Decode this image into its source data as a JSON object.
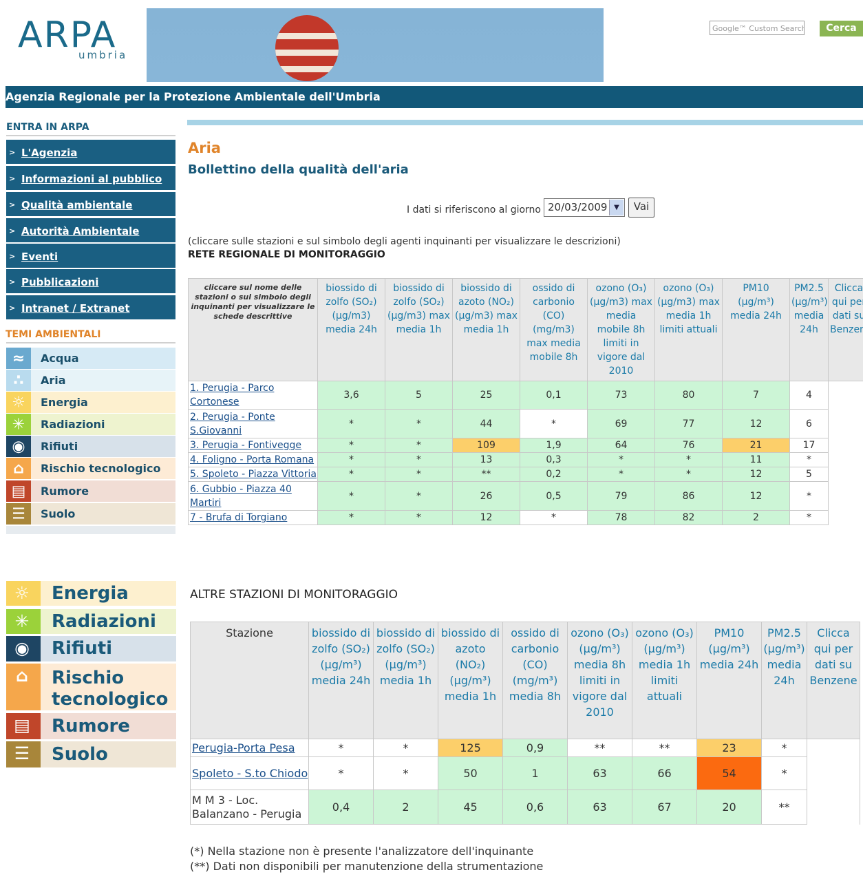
{
  "header": {
    "logo_text": "ARPA",
    "logo_sub": "umbria",
    "search_placeholder": "Google™ Custom Search",
    "search_button": "Cerca",
    "agency_name": "Agenzia  Regionale per la Protezione Ambientale dell'Umbria"
  },
  "sidebar": {
    "entra_heading": "ENTRA IN ARPA",
    "nav": [
      "L'Agenzia",
      "Informazioni al pubblico",
      "Qualità ambientale",
      "Autorità Ambientale",
      "Eventi",
      "Pubblicazioni",
      "Intranet / Extranet"
    ],
    "temi_heading": "TEMI AMBIENTALI",
    "temi": [
      {
        "label": "Acqua",
        "icon": "water-icon",
        "bg": "#d6eaf5",
        "iconbg": "#6aa9cf"
      },
      {
        "label": "Aria",
        "icon": "air-icon",
        "bg": "#e7f3f8",
        "iconbg": "#b9dbee"
      },
      {
        "label": "Energia",
        "icon": "sun-icon",
        "bg": "#fdf0cf",
        "iconbg": "#f9d45e"
      },
      {
        "label": "Radiazioni",
        "icon": "radiation-icon",
        "bg": "#eef3cf",
        "iconbg": "#9bd23a"
      },
      {
        "label": "Rifiuti",
        "icon": "waste-icon",
        "bg": "#d7e1ea",
        "iconbg": "#1e4563"
      },
      {
        "label": "Rischio tecnologico",
        "icon": "industry-icon",
        "bg": "#fdebd6",
        "iconbg": "#f5a74b"
      },
      {
        "label": "Rumore",
        "icon": "noise-icon",
        "bg": "#f1ddd5",
        "iconbg": "#c0462a"
      },
      {
        "label": "Suolo",
        "icon": "soil-icon",
        "bg": "#efe6d6",
        "iconbg": "#a8863a"
      }
    ],
    "temi_lower": [
      {
        "label": "Energia",
        "icon": "sun-icon",
        "bg": "#fdf0cf",
        "iconbg": "#f9d45e"
      },
      {
        "label": "Radiazioni",
        "icon": "radiation-icon",
        "bg": "#eef3cf",
        "iconbg": "#9bd23a"
      },
      {
        "label": "Rifiuti",
        "icon": "waste-icon",
        "bg": "#d7e1ea",
        "iconbg": "#1e4563"
      },
      {
        "label": "Rischio tecnologico",
        "icon": "industry-icon",
        "bg": "#fdebd6",
        "iconbg": "#f5a74b"
      },
      {
        "label": "Rumore",
        "icon": "noise-icon",
        "bg": "#f1ddd5",
        "iconbg": "#c0462a"
      },
      {
        "label": "Suolo",
        "icon": "soil-icon",
        "bg": "#efe6d6",
        "iconbg": "#a8863a"
      }
    ]
  },
  "main": {
    "title": "Aria",
    "subtitle": "Bollettino della qualità dell'aria",
    "date_label": "I dati si riferiscono al giorno",
    "date_value": "20/03/2009",
    "go_button": "Vai",
    "instructions": "(cliccare sulle stazioni e sul simbolo degli agenti inquinanti per visualizzare le descrizioni)",
    "network_label": "RETE REGIONALE DI MONITORAGGIO",
    "altre_label": "ALTRE STAZIONI DI MONITORAGGIO",
    "note1": "(*) Nella stazione non è presente l'analizzatore dell'inquinante",
    "note2": "(**) Dati non disponibili per manutenzione della strumentazione"
  },
  "table1": {
    "first_header": "cliccare sul nome delle stazioni o sul simbolo degli inquinanti per visualizzare le schede descrittive",
    "headers": [
      "biossido di zolfo (SO₂) (µg/m3) media 24h",
      "biossido di zolfo (SO₂) (µg/m3) max media 1h",
      "biossido di azoto (NO₂) (µg/m3) max media 1h",
      "ossido di carbonio (CO) (mg/m3) max media mobile 8h",
      "ozono (O₃) (µg/m3) max media mobile 8h limiti in vigore dal 2010",
      "ozono (O₃) (µg/m3) max media 1h limiti attuali",
      "PM10 (µg/m³) media 24h",
      "PM2.5 (µg/m³) media 24h",
      "Clicca qui per dati su Benzene"
    ],
    "rows": [
      {
        "station": "1. Perugia - Parco Cortonese",
        "cells": [
          [
            "3,6",
            "g"
          ],
          [
            "5",
            "g"
          ],
          [
            "25",
            "g"
          ],
          [
            "0,1",
            "g"
          ],
          [
            "73",
            "g"
          ],
          [
            "80",
            "g"
          ],
          [
            "7",
            "g"
          ],
          [
            "4",
            "w"
          ]
        ]
      },
      {
        "station": "2. Perugia - Ponte S.Giovanni",
        "cells": [
          [
            "*",
            "g"
          ],
          [
            "*",
            "g"
          ],
          [
            "44",
            "g"
          ],
          [
            "*",
            "w"
          ],
          [
            "69",
            "g"
          ],
          [
            "77",
            "g"
          ],
          [
            "12",
            "g"
          ],
          [
            "6",
            "w"
          ]
        ]
      },
      {
        "station": "3. Perugia - Fontivegge",
        "cells": [
          [
            "*",
            "g"
          ],
          [
            "*",
            "g"
          ],
          [
            "109",
            "o"
          ],
          [
            "1,9",
            "g"
          ],
          [
            "64",
            "g"
          ],
          [
            "76",
            "g"
          ],
          [
            "21",
            "o"
          ],
          [
            "17",
            "w"
          ]
        ]
      },
      {
        "station": "4. Foligno - Porta Romana",
        "cells": [
          [
            "*",
            "g"
          ],
          [
            "*",
            "g"
          ],
          [
            "13",
            "g"
          ],
          [
            "0,3",
            "g"
          ],
          [
            "*",
            "g"
          ],
          [
            "*",
            "g"
          ],
          [
            "11",
            "g"
          ],
          [
            "*",
            "w"
          ]
        ]
      },
      {
        "station": "5. Spoleto - Piazza Vittoria",
        "cells": [
          [
            "*",
            "g"
          ],
          [
            "*",
            "g"
          ],
          [
            "**",
            "g"
          ],
          [
            "0,2",
            "g"
          ],
          [
            "*",
            "g"
          ],
          [
            "*",
            "g"
          ],
          [
            "12",
            "g"
          ],
          [
            "5",
            "w"
          ]
        ]
      },
      {
        "station": "6. Gubbio - Piazza 40 Martiri",
        "cells": [
          [
            "*",
            "g"
          ],
          [
            "*",
            "g"
          ],
          [
            "26",
            "g"
          ],
          [
            "0,5",
            "g"
          ],
          [
            "79",
            "g"
          ],
          [
            "86",
            "g"
          ],
          [
            "12",
            "g"
          ],
          [
            "*",
            "w"
          ]
        ]
      },
      {
        "station": "7 - Brufa di Torgiano",
        "cells": [
          [
            "*",
            "g"
          ],
          [
            "*",
            "g"
          ],
          [
            "12",
            "g"
          ],
          [
            "*",
            "w"
          ],
          [
            "78",
            "g"
          ],
          [
            "82",
            "g"
          ],
          [
            "2",
            "g"
          ],
          [
            "*",
            "w"
          ]
        ]
      }
    ]
  },
  "table2": {
    "first_header": "Stazione",
    "headers": [
      "biossido di zolfo (SO₂) (µg/m³) media 24h",
      "biossido di zolfo (SO₂) (µg/m³) media 1h",
      "biossido di azoto (NO₂) (µg/m³) media 1h",
      "ossido di carbonio (CO) (mg/m³) media 8h",
      "ozono (O₃) (µg/m³) media 8h limiti in vigore dal 2010",
      "ozono (O₃) (µg/m³) media 1h limiti attuali",
      "PM10 (µg/m³) media 24h",
      "PM2.5 (µg/m³) media 24h",
      "Clicca qui per dati su Benzene"
    ],
    "rows": [
      {
        "station": "Perugia-Porta Pesa",
        "link": true,
        "cells": [
          [
            "*",
            "w"
          ],
          [
            "*",
            "w"
          ],
          [
            "125",
            "o"
          ],
          [
            "0,9",
            "g"
          ],
          [
            "**",
            "w"
          ],
          [
            "**",
            "w"
          ],
          [
            "23",
            "o"
          ],
          [
            "*",
            "w"
          ]
        ]
      },
      {
        "station": "Spoleto - S.to Chiodo",
        "link": true,
        "cells": [
          [
            "*",
            "w"
          ],
          [
            "*",
            "w"
          ],
          [
            "50",
            "g"
          ],
          [
            "1",
            "g"
          ],
          [
            "63",
            "g"
          ],
          [
            "66",
            "g"
          ],
          [
            "54",
            "r"
          ],
          [
            "*",
            "w"
          ]
        ]
      },
      {
        "station": "M M 3 - Loc. Balanzano - Perugia",
        "link": false,
        "cells": [
          [
            "0,4",
            "g"
          ],
          [
            "2",
            "g"
          ],
          [
            "45",
            "g"
          ],
          [
            "0,6",
            "g"
          ],
          [
            "63",
            "g"
          ],
          [
            "67",
            "g"
          ],
          [
            "20",
            "g"
          ],
          [
            "**",
            "w"
          ]
        ]
      }
    ]
  },
  "colors": {
    "green": "#ccf5d6",
    "orange": "#fccf6a",
    "red": "#fb6a10",
    "nav": "#1a5f82",
    "brand": "#125879"
  }
}
